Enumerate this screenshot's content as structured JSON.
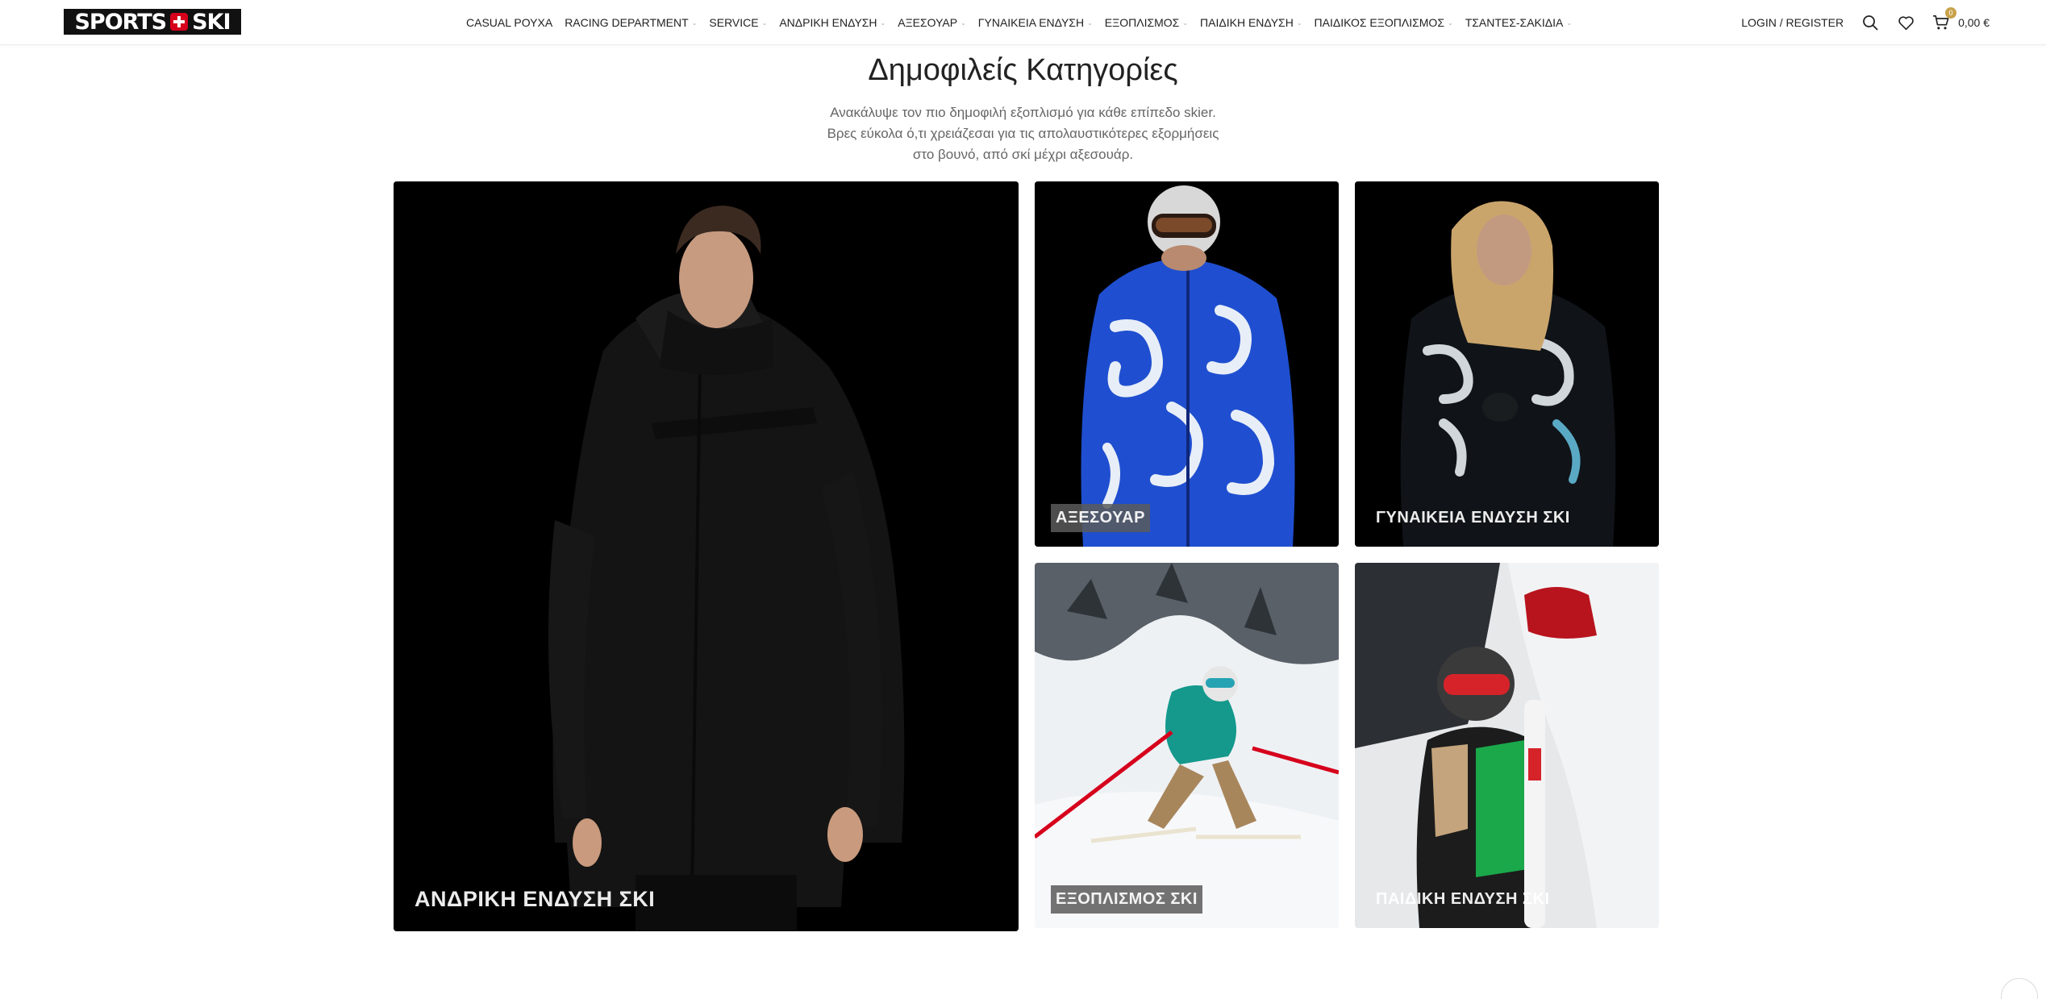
{
  "header": {
    "logo_text_left": "SPORTS",
    "logo_text_right": "SKI",
    "nav": [
      {
        "label": "CASUAL ΡΟΥΧΑ",
        "has_dropdown": false
      },
      {
        "label": "RACING DEPARTMENT",
        "has_dropdown": true
      },
      {
        "label": "SERVICE",
        "has_dropdown": true
      },
      {
        "label": "ΑΝΔΡΙΚΗ ΕΝΔΥΣΗ",
        "has_dropdown": true
      },
      {
        "label": "ΑΞΕΣΟΥΑΡ",
        "has_dropdown": true
      },
      {
        "label": "ΓΥΝΑΙΚΕΙΑ ΕΝΔΥΣΗ",
        "has_dropdown": true
      },
      {
        "label": "ΕΞΟΠΛΙΣΜΟΣ",
        "has_dropdown": true
      },
      {
        "label": "ΠΑΙΔΙΚΗ ΕΝΔΥΣΗ",
        "has_dropdown": true
      },
      {
        "label": "ΠΑΙΔΙΚΟΣ ΕΞΟΠΛΙΣΜΟΣ",
        "has_dropdown": true
      },
      {
        "label": "ΤΣΑΝΤΕΣ-ΣΑΚΙΔΙΑ",
        "has_dropdown": true
      }
    ],
    "login_label": "LOGIN / REGISTER",
    "cart_count": "0",
    "cart_total": "0,00 €",
    "icons": [
      "search-icon",
      "heart-icon",
      "cart-icon"
    ]
  },
  "section": {
    "title": "Δημοφιλείς Κατηγορίες",
    "subtitle_line1": "Ανακάλυψε τον πιο δημοφιλή εξοπλισμό για κάθε επίπεδο skier.",
    "subtitle_line2": "Βρες εύκολα ό,τι χρειάζεσαι για τις απολαυστικότερες εξορμήσεις",
    "subtitle_line3": "στο βουνό, από σκί μέχρι αξεσουάρ."
  },
  "tiles": {
    "men": "ΑΝΔΡΙΚΗ ΕΝΔΥΣΗ ΣΚΙ",
    "accessories": "ΑΞΕΣΟΥΑΡ",
    "women": "ΓΥΝΑΙΚΕΙΑ ΕΝΔΥΣΗ ΣΚΙ",
    "equipment": "ΕΞΟΠΛΙΣΜΟΣ ΣΚΙ",
    "kids": "ΠΑΙΔΙΚΗ ΕΝΔΥΣΗ ΣΚΙ"
  },
  "colors": {
    "logo_bg": "#111111",
    "logo_cross": "#d6001c",
    "cart_badge": "#c8a24a",
    "blue_jacket": "#1f4fd0",
    "teal_jacket": "#14998c",
    "green_jacket": "#1aa84a"
  }
}
